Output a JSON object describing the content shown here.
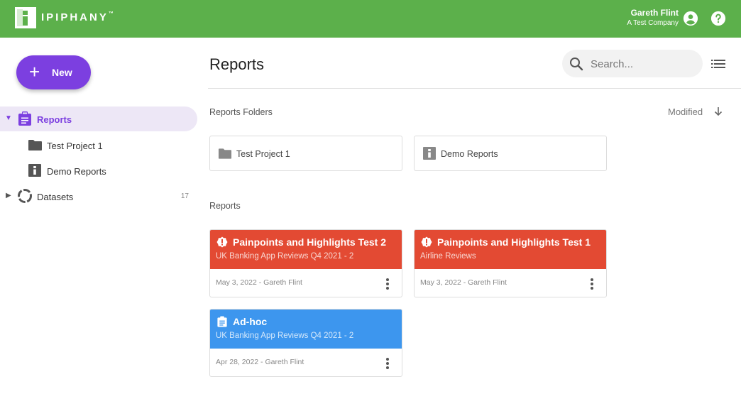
{
  "app": {
    "logo_text": "IPIPHANY",
    "logo_tm": "™",
    "user_name": "Gareth Flint",
    "user_company": "A Test Company"
  },
  "sidebar": {
    "new_label": "New",
    "items": [
      {
        "label": "Reports",
        "icon": "clipboard-icon"
      },
      {
        "label": "Test Project 1",
        "icon": "folder-icon"
      },
      {
        "label": "Demo Reports",
        "icon": "info-folder-icon"
      },
      {
        "label": "Datasets",
        "icon": "dataset-ring-icon",
        "count": "17"
      }
    ]
  },
  "main": {
    "title": "Reports",
    "search_placeholder": "Search...",
    "folders_title": "Reports Folders",
    "sort_label": "Modified",
    "folders": [
      {
        "label": "Test Project 1",
        "icon": "folder-icon"
      },
      {
        "label": "Demo Reports",
        "icon": "info-folder-icon"
      }
    ],
    "reports_title": "Reports",
    "reports": [
      {
        "title": "Painpoints and Highlights Test 2",
        "subtitle": "UK Banking App Reviews Q4 2021 - 2",
        "meta": "May 3, 2022 - Gareth Flint",
        "color": "#e34a33",
        "icon": "alert-icon"
      },
      {
        "title": "Painpoints and Highlights Test 1",
        "subtitle": "Airline Reviews",
        "meta": "May 3, 2022 - Gareth Flint",
        "color": "#e34a33",
        "icon": "alert-icon"
      },
      {
        "title": "Ad-hoc",
        "subtitle": "UK Banking App Reviews Q4 2021 - 2",
        "meta": "Apr 28, 2022 - Gareth Flint",
        "color": "#3d96ee",
        "icon": "clipboard-icon"
      }
    ]
  },
  "colors": {
    "topbar": "#5cb04b",
    "accent": "#7c3fe0",
    "alert_card": "#e34a33",
    "info_card": "#3d96ee"
  }
}
